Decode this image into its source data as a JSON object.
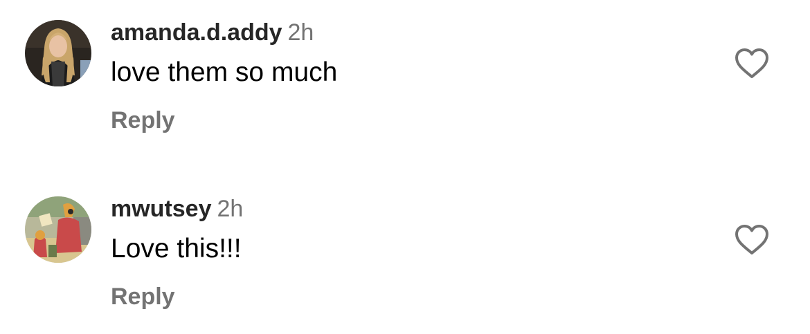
{
  "comments": [
    {
      "username": "amanda.d.addy",
      "timestamp": "2h",
      "text": "love them so much",
      "reply_label": "Reply",
      "avatar_icon": "profile-photo",
      "like_icon": "heart-outline-icon"
    },
    {
      "username": "mwutsey",
      "timestamp": "2h",
      "text": "Love this!!!",
      "reply_label": "Reply",
      "avatar_icon": "profile-photo",
      "like_icon": "heart-outline-icon"
    }
  ],
  "colors": {
    "username": "#262626",
    "secondary": "#737373",
    "text": "#000000",
    "background": "#ffffff"
  }
}
